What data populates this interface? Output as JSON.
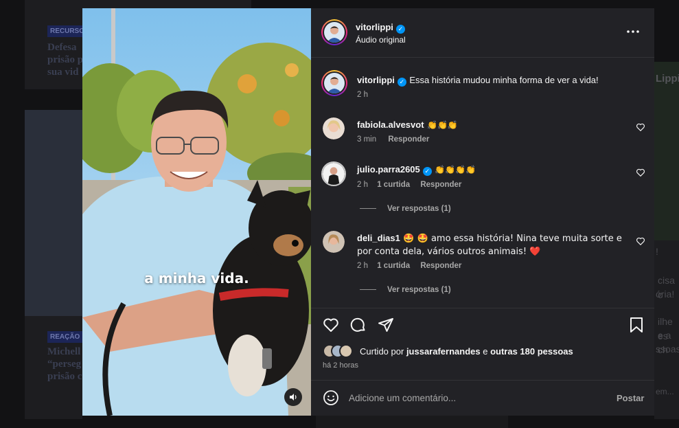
{
  "background": {
    "tags": [
      "RECURSO",
      "REAÇÃO"
    ],
    "left_snippets": [
      "Defesa",
      "prisão p",
      "sua vid",
      "Michell",
      "“perseg",
      "prisão c"
    ],
    "right_snippets": [
      "Lippi",
      "!",
      "cisa c",
      "ória!",
      "ilhe es",
      "e a ch",
      "ssoas!",
      "em..."
    ]
  },
  "media": {
    "caption": "a minha vida.",
    "volume_icon": "speaker-icon"
  },
  "header": {
    "username": "vitorlippi",
    "audio": "Áudio original",
    "more_icon": "more-icon"
  },
  "caption": {
    "username": "vitorlippi",
    "text": "Essa história mudou minha forma de ver a vida!",
    "time": "2 h"
  },
  "comments": [
    {
      "username": "fabiola.alvesvot",
      "text": "👏👏👏",
      "time": "3 min",
      "reply": "Responder"
    },
    {
      "username": "julio.parra2605",
      "text": "👏👏👏👏",
      "time": "2 h",
      "likes": "1 curtida",
      "reply": "Responder",
      "view_replies": "Ver respostas (1)"
    },
    {
      "username": "deli_dias1",
      "text": "🤩 🤩  amo essa história! Nina teve muita sorte e por conta dela, vários outros animais! ❤️",
      "time": "2 h",
      "likes": "1 curtida",
      "reply": "Responder",
      "view_replies": "Ver respostas (1)"
    }
  ],
  "actions": {
    "liked_prefix": "Curtido por",
    "liked_user": "jussarafernandes",
    "liked_and": "e",
    "liked_others": "outras 180 pessoas",
    "timestamp": "há 2 horas"
  },
  "composer": {
    "placeholder": "Adicione um comentário...",
    "post_label": "Postar"
  },
  "colors": {
    "accent": "#0095f6",
    "panel": "#222226",
    "heart_red": "#e0245e"
  }
}
